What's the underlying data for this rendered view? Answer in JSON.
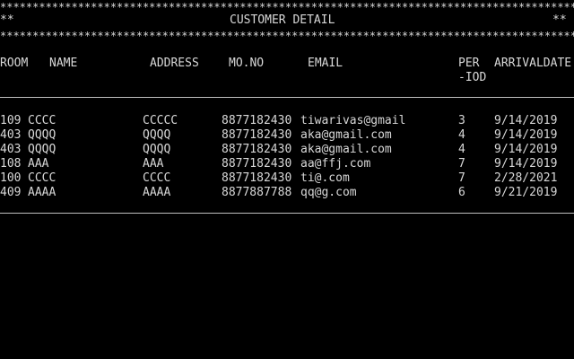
{
  "screen": {
    "title_prefix": "**",
    "title": "CUSTOMER DETAIL",
    "title_suffix": "**",
    "star_line": "**************************************************************************************************************"
  },
  "headers": {
    "room": "ROOM",
    "name": "NAME",
    "address": "ADDRESS",
    "mono": "MO.NO",
    "email": "EMAIL",
    "period_line1": "PER",
    "period_line2": "-IOD",
    "arrival": "ARRIVALDATE"
  },
  "rows": [
    {
      "room": "109",
      "name": "CCCC",
      "address": "CCCCC",
      "mono": "8877182430",
      "email": "tiwarivas@gmail",
      "period": "3",
      "arrival": "9/14/2019"
    },
    {
      "room": "403",
      "name": "QQQQ",
      "address": "QQQQ",
      "mono": "8877182430",
      "email": "aka@gmail.com",
      "period": "4",
      "arrival": "9/14/2019"
    },
    {
      "room": "403",
      "name": "QQQQ",
      "address": "QQQQ",
      "mono": "8877182430",
      "email": "aka@gmail.com",
      "period": "4",
      "arrival": "9/14/2019"
    },
    {
      "room": "108",
      "name": "AAA",
      "address": "AAA",
      "mono": "8877182430",
      "email": "aa@ffj.com",
      "period": "7",
      "arrival": "9/14/2019"
    },
    {
      "room": "100",
      "name": "CCCC",
      "address": "CCCC",
      "mono": "8877182430",
      "email": "ti@.com",
      "period": "7",
      "arrival": "2/28/2021"
    },
    {
      "room": "409",
      "name": "AAAA",
      "address": "AAAA",
      "mono": "8877887788",
      "email": "qq@g.com",
      "period": "6",
      "arrival": "9/21/2019"
    }
  ],
  "colors": {
    "background": "#000000",
    "text": "#d8d8d8",
    "rule": "#bfbfbf"
  }
}
